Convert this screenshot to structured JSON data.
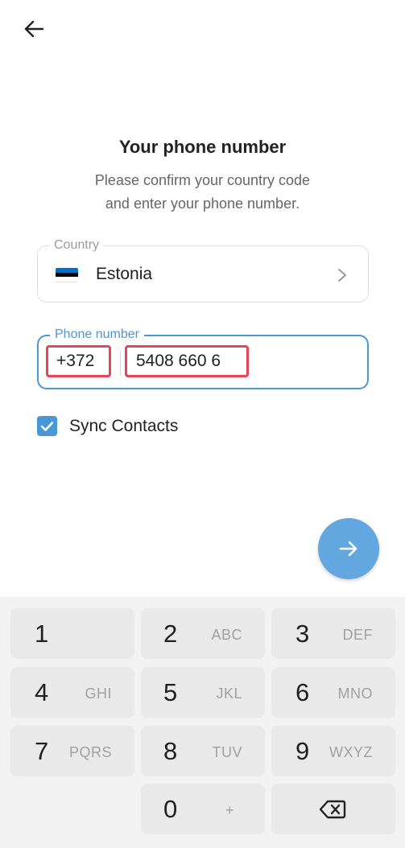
{
  "header": {
    "back_icon": "arrow-left-icon"
  },
  "title": "Your phone number",
  "subtitle_line1": "Please confirm your country code",
  "subtitle_line2": "and enter your phone number.",
  "country": {
    "legend": "Country",
    "name": "Estonia",
    "flag_colors": [
      "#0072ce",
      "#000000",
      "#ffffff"
    ]
  },
  "phone": {
    "legend": "Phone number",
    "code": "+372",
    "number": "5408 660 6"
  },
  "sync": {
    "label": "Sync Contacts",
    "checked": true
  },
  "keypad": {
    "keys": [
      {
        "digit": "1",
        "letters": ""
      },
      {
        "digit": "2",
        "letters": "ABC"
      },
      {
        "digit": "3",
        "letters": "DEF"
      },
      {
        "digit": "4",
        "letters": "GHI"
      },
      {
        "digit": "5",
        "letters": "JKL"
      },
      {
        "digit": "6",
        "letters": "MNO"
      },
      {
        "digit": "7",
        "letters": "PQRS"
      },
      {
        "digit": "8",
        "letters": "TUV"
      },
      {
        "digit": "9",
        "letters": "WXYZ"
      },
      {
        "digit": "0",
        "letters": "+"
      }
    ]
  },
  "colors": {
    "accent": "#4a97d8",
    "highlight": "#e5445a",
    "fab": "#62a7e0"
  }
}
